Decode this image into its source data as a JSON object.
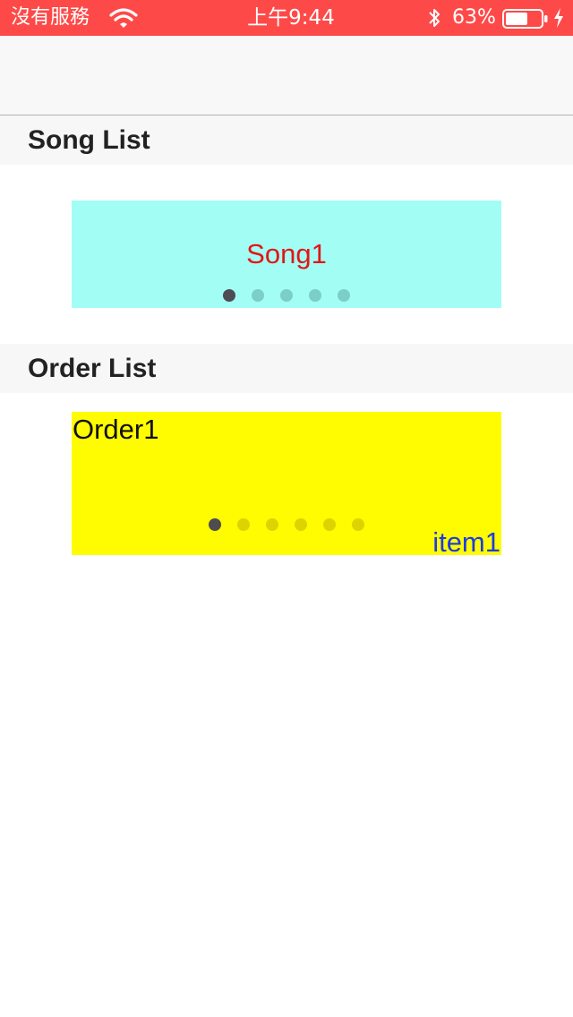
{
  "status_bar": {
    "carrier": "沒有服務",
    "time": "上午9:44",
    "battery_percent": "63%",
    "battery_level": 0.63,
    "icons": [
      "wifi-icon",
      "bluetooth-icon",
      "battery-icon",
      "charging-icon"
    ],
    "background": "#fd4a48"
  },
  "sections": {
    "song": {
      "header": "Song List",
      "card_title": "Song1",
      "page_count": 5,
      "current_page": 1,
      "card_color": "#a2fdf5",
      "title_color": "#e31515"
    },
    "order": {
      "header": "Order List",
      "card_title": "Order1",
      "item_label": "item1",
      "page_count": 6,
      "current_page": 1,
      "card_color": "#fffb00",
      "item_color": "#1c3ce0"
    }
  }
}
